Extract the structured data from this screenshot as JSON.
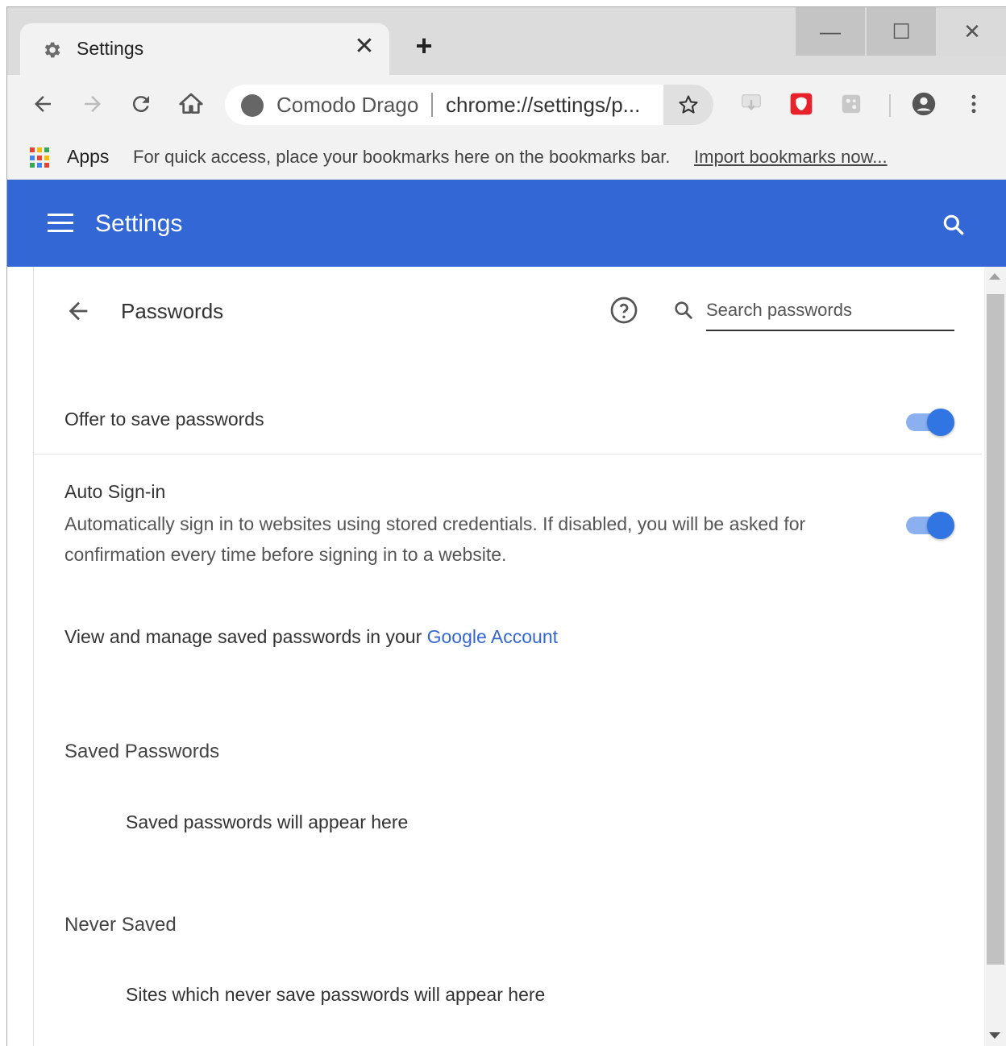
{
  "browser": {
    "tab": {
      "title": "Settings",
      "close_glyph": "✕"
    },
    "new_tab_glyph": "+",
    "window_controls": {
      "minimize": "—",
      "maximize": "☐",
      "close": "✕"
    },
    "omnibox": {
      "site_name": "Comodo Dragon",
      "url": "chrome://settings/p..."
    },
    "bookmarks": {
      "apps_label": "Apps",
      "hint": "For quick access, place your bookmarks here on the bookmarks bar.",
      "import_link": "Import bookmarks now..."
    },
    "icons": {
      "back": "back-arrow-icon",
      "forward": "forward-arrow-icon",
      "reload": "reload-icon",
      "home": "home-icon",
      "star": "star-icon",
      "extensions": [
        "download-extension-icon",
        "red-shield-icon",
        "puzzle-extension-icon"
      ],
      "profile": "profile-icon",
      "menu": "kebab-menu-icon"
    }
  },
  "settings": {
    "header_title": "Settings",
    "header_color": "#3367d6",
    "page_title": "Passwords",
    "search_placeholder": "Search passwords",
    "offer_to_save": {
      "label": "Offer to save passwords",
      "enabled": true
    },
    "auto_signin": {
      "label": "Auto Sign-in",
      "description": "Automatically sign in to websites using stored credentials. If disabled, you will be asked for confirmation every time before signing in to a website.",
      "enabled": true
    },
    "google_account": {
      "text": "View and manage saved passwords in your",
      "link": "Google Account"
    },
    "saved_passwords": {
      "title": "Saved Passwords",
      "empty": "Saved passwords will appear here"
    },
    "never_saved": {
      "title": "Never Saved",
      "empty": "Sites which never save passwords will appear here"
    },
    "accent_color": "#3175e3",
    "link_color": "#3367d6"
  }
}
